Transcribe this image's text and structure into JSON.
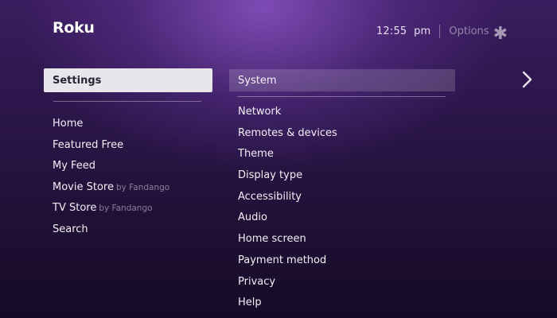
{
  "header": {
    "logo": "Roku",
    "clock": "12:55  pm",
    "options_label": "Options",
    "options_icon": "asterisk-icon"
  },
  "left_menu": {
    "selected": "Settings",
    "items": [
      {
        "label": "Home",
        "sub": ""
      },
      {
        "label": "Featured Free",
        "sub": ""
      },
      {
        "label": "My Feed",
        "sub": ""
      },
      {
        "label": "Movie Store",
        "sub": "by Fandango"
      },
      {
        "label": "TV Store",
        "sub": "by Fandango"
      },
      {
        "label": "Search",
        "sub": ""
      }
    ]
  },
  "settings_menu": {
    "header": "System",
    "items": [
      "Network",
      "Remotes & devices",
      "Theme",
      "Display type",
      "Accessibility",
      "Audio",
      "Home screen",
      "Payment method",
      "Privacy",
      "Help"
    ]
  },
  "colors": {
    "background_top": "#3a1d5e",
    "background_bottom": "#160b27",
    "selected_item_bg": "#e8e6ea",
    "selected_item_text": "#2a2536"
  }
}
